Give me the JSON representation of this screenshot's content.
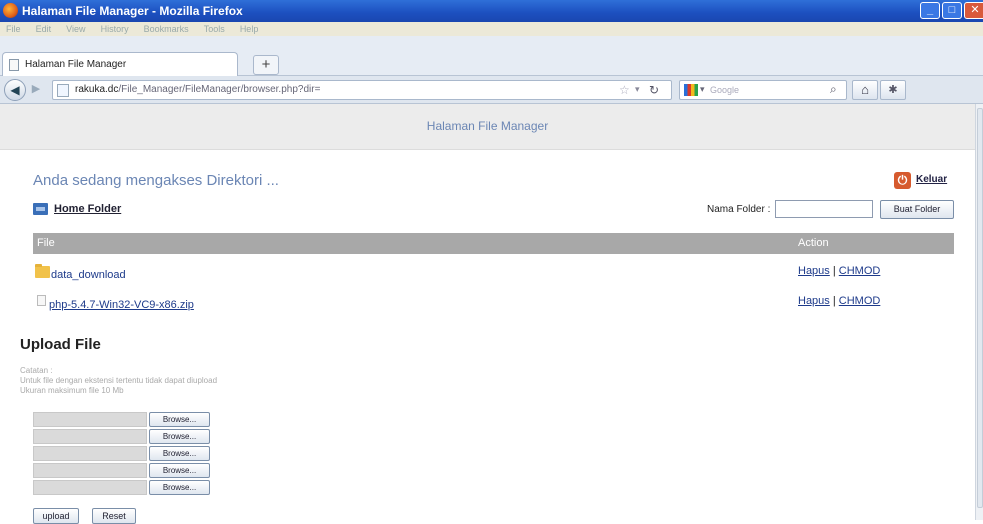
{
  "window": {
    "title": "Halaman File Manager - Mozilla Firefox",
    "min_icon": "minimize-icon",
    "max_icon": "maximize-icon",
    "close_icon": "close-icon"
  },
  "menu": [
    "File",
    "Edit",
    "View",
    "History",
    "Bookmarks",
    "Tools",
    "Help"
  ],
  "tabs": [
    {
      "label": "Halaman File Manager"
    }
  ],
  "newtab": "+",
  "nav": {
    "url_domain": "rakuka.dc",
    "url_path": "/File_Manager/FileManager/browser.php?dir=",
    "search_placeholder": "Google"
  },
  "page": {
    "header_title": "Halaman File Manager",
    "access_title": "Anda sedang mengakses Direktori ...",
    "logout_label": "Keluar",
    "home_folder_label": "Home Folder",
    "folder_name_label": "Nama Folder :",
    "folder_name_value": "",
    "make_folder_label": "Buat Folder"
  },
  "table": {
    "headers": {
      "file": "File",
      "action": "Action"
    },
    "rows": [
      {
        "type": "folder",
        "name": "data_download",
        "delete": "Hapus",
        "sep": " | ",
        "chmod": "CHMOD"
      },
      {
        "type": "file",
        "name": "php-5.4.7-Win32-VC9-x86.zip",
        "delete": "Hapus",
        "sep": " | ",
        "chmod": "CHMOD"
      }
    ]
  },
  "upload": {
    "title": "Upload File",
    "note_lines": [
      "Catatan :",
      "Untuk file dengan ekstensi tertentu tidak dapat diupload",
      "Ukuran maksimum file 10 Mb"
    ],
    "browse_label": "Browse...",
    "upload_label": "upload",
    "reset_label": "Reset"
  }
}
